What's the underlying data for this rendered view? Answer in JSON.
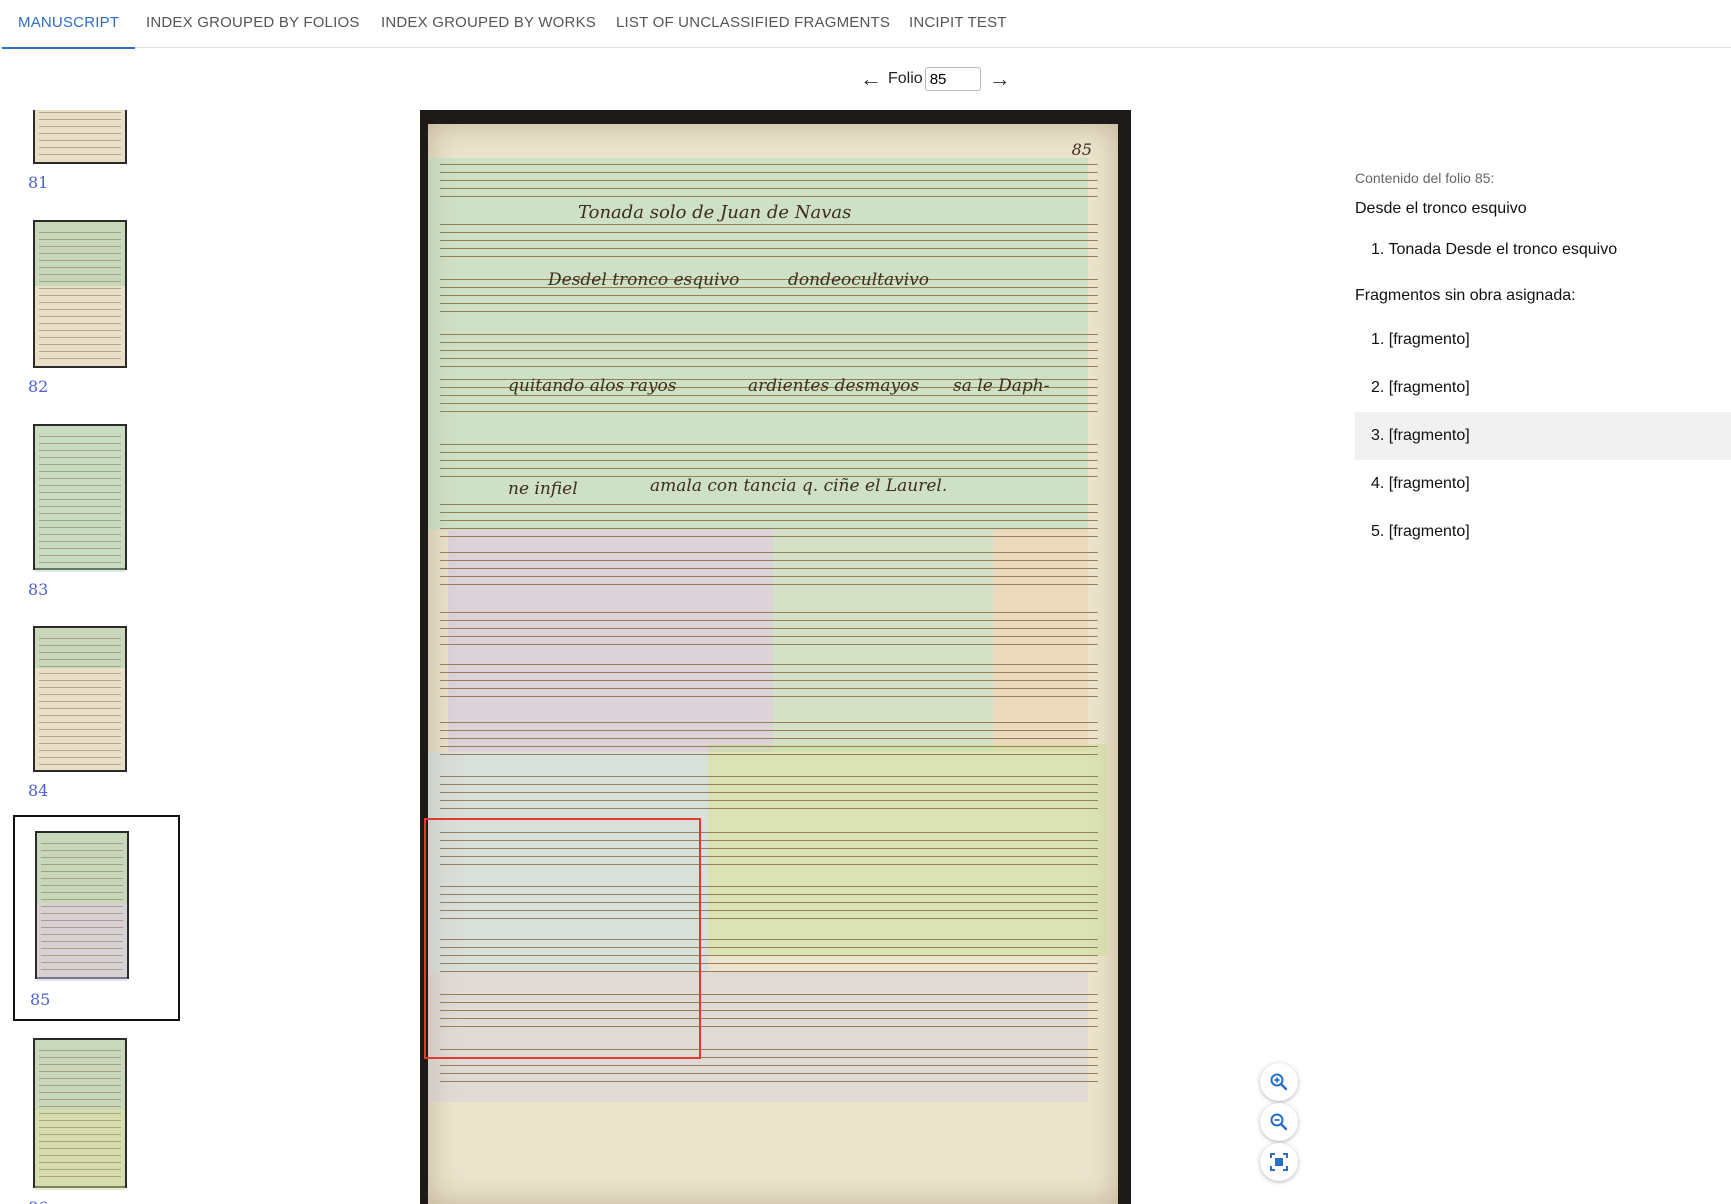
{
  "tabs": [
    {
      "label": "MANUSCRIPT",
      "active": true
    },
    {
      "label": "INDEX GROUPED BY FOLIOS"
    },
    {
      "label": "INDEX GROUPED BY WORKS"
    },
    {
      "label": "LIST OF UNCLASSIFIED FRAGMENTS"
    },
    {
      "label": "INCIPIT TEST"
    }
  ],
  "folio_nav": {
    "label": "Folio",
    "value": "85",
    "prev_icon": "arrow-left-icon",
    "next_icon": "arrow-right-icon"
  },
  "thumbnails": [
    {
      "number": "81"
    },
    {
      "number": "82"
    },
    {
      "number": "83"
    },
    {
      "number": "84"
    },
    {
      "number": "85",
      "selected": true
    },
    {
      "number": "86"
    }
  ],
  "page": {
    "folio_mark": "85",
    "title": "Tonada solo    de Juan de Navas",
    "lyrics": [
      "Desdel tronco esquivo",
      "dondeocultavivo",
      "quitando alos rayos",
      "ardientes desmayos",
      "sa le Daph-",
      "ne infiel",
      "amala con tancia  q. ciñe el Laurel."
    ]
  },
  "zoom": {
    "in_icon": "zoom-in-icon",
    "out_icon": "zoom-out-icon",
    "fit_icon": "fit-screen-icon",
    "color": "#2b6fc6"
  },
  "panel": {
    "caption": "Contenido del folio 85:",
    "work_title": "Desde el tronco esquivo",
    "works": [
      "1. Tonada Desde el tronco esquivo"
    ],
    "fragments_title": "Fragmentos sin obra asignada:",
    "fragments": [
      {
        "label": "1. [fragmento]"
      },
      {
        "label": "2. [fragmento]"
      },
      {
        "label": "3. [fragmento]",
        "highlighted": true
      },
      {
        "label": "4. [fragmento]"
      },
      {
        "label": "5. [fragmento]"
      }
    ]
  },
  "colors": {
    "accent": "#2b6fc6",
    "thumb_number": "#4a5fd9",
    "highlight": "#e23a2e"
  }
}
